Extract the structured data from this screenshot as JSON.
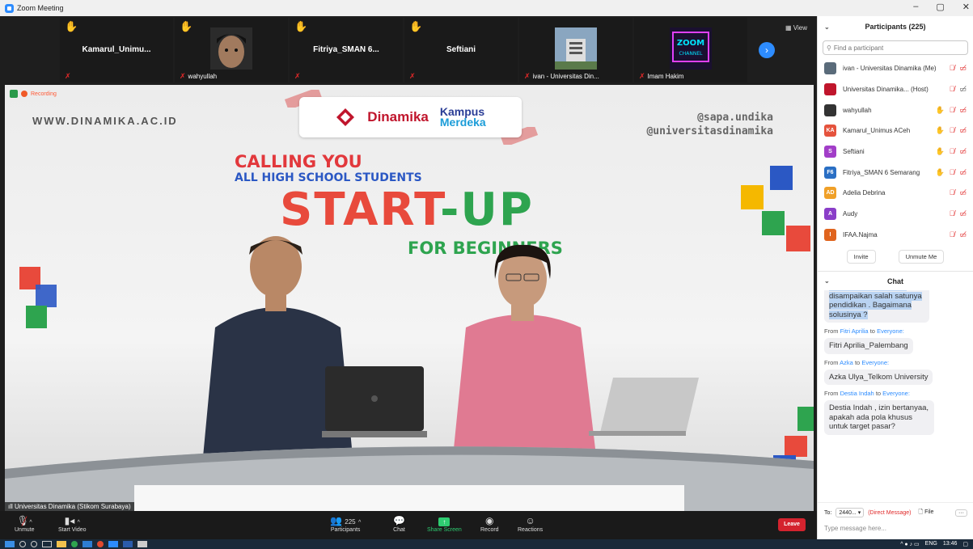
{
  "window": {
    "title": "Zoom Meeting",
    "controls": [
      "–",
      "▢",
      "✕"
    ]
  },
  "gallery": {
    "view_label": "View",
    "tiles": [
      {
        "name": "Kamarul_Unimu...",
        "footer": "",
        "hand": true
      },
      {
        "name": "",
        "footer": "wahyullah",
        "hand": true
      },
      {
        "name": "Fitriya_SMAN 6...",
        "footer": "",
        "hand": true
      },
      {
        "name": "Seftiani",
        "footer": "",
        "hand": true
      },
      {
        "name": "",
        "footer": "ivan - Universitas Din...",
        "hand": false
      },
      {
        "name": "",
        "footer": "Imam Hakim",
        "hand": false
      }
    ]
  },
  "video": {
    "speaker_label": "Universitas Dinamika (Stikom Surabaya)",
    "recording_label": "Recording",
    "www": "WWW.DINAMIKA.AC.ID",
    "social1": "@sapa.undika",
    "social2": "@universitasdinamika",
    "logo_dinamika": "Dinamika",
    "logo_kampus": "Kampus",
    "logo_merdeka": "Merdeka",
    "calling": "CALLING YOU",
    "all_hs": "ALL HIGH SCHOOL STUDENTS",
    "start": "START",
    "up": "-UP",
    "beginners": "FOR BEGINNERS"
  },
  "toolbar": {
    "unmute": "Unmute",
    "start_video": "Start Video",
    "participants": "Participants",
    "participant_count": "225",
    "chat": "Chat",
    "share": "Share Screen",
    "record": "Record",
    "reactions": "Reactions",
    "leave": "Leave"
  },
  "participants": {
    "title": "Participants (225)",
    "search_placeholder": "Find a participant",
    "list": [
      {
        "initials": "",
        "color": "#5a6b7a",
        "name": "ivan - Universitas Dinamika (Me)",
        "hand": false,
        "video": true
      },
      {
        "initials": "",
        "color": "#c0152c",
        "name": "Universitas Dinamika... (Host)",
        "hand": false,
        "video": false
      },
      {
        "initials": "",
        "color": "#333333",
        "name": "wahyullah",
        "hand": true,
        "video": true
      },
      {
        "initials": "KA",
        "color": "#e5533d",
        "name": "Kamarul_Unimus ACeh",
        "hand": true,
        "video": true
      },
      {
        "initials": "S",
        "color": "#a23ec8",
        "name": "Seftiani",
        "hand": true,
        "video": true
      },
      {
        "initials": "F6",
        "color": "#2a6fc4",
        "name": "Fitriya_SMAN 6 Semarang",
        "hand": true,
        "video": true
      },
      {
        "initials": "AD",
        "color": "#f0a028",
        "name": "Adelia Debrina",
        "hand": false,
        "video": true
      },
      {
        "initials": "A",
        "color": "#8a3ec8",
        "name": "Audy",
        "hand": false,
        "video": true
      },
      {
        "initials": "I",
        "color": "#e0641e",
        "name": "IFAA.Najma",
        "hand": false,
        "video": true
      }
    ],
    "invite": "Invite",
    "unmute_me": "Unmute Me"
  },
  "chat": {
    "title": "Chat",
    "first_bubble": "point-point yang sudah disampaikan salah satunya pendidikan . Bagaimana solusinya ?",
    "messages": [
      {
        "from": "Fitri Aprilia",
        "to": "Everyone:",
        "text": "Fitri Aprilia_Palembang"
      },
      {
        "from": "Azka",
        "to": "Everyone:",
        "text": "Azka Ulya_Telkom University"
      },
      {
        "from": "Destia Indah",
        "to": "Everyone:",
        "text": "Destia Indah , izin bertanyaa, apakah ada pola khusus untuk target pasar?"
      }
    ],
    "from_word": "From",
    "to_word": "to",
    "to_label": "To:",
    "to_value": "2440... ▾",
    "direct": "(Direct Message)",
    "file": "File",
    "type_placeholder": "Type message here..."
  },
  "taskbar": {
    "lang": "ENG",
    "time": "13:46"
  }
}
